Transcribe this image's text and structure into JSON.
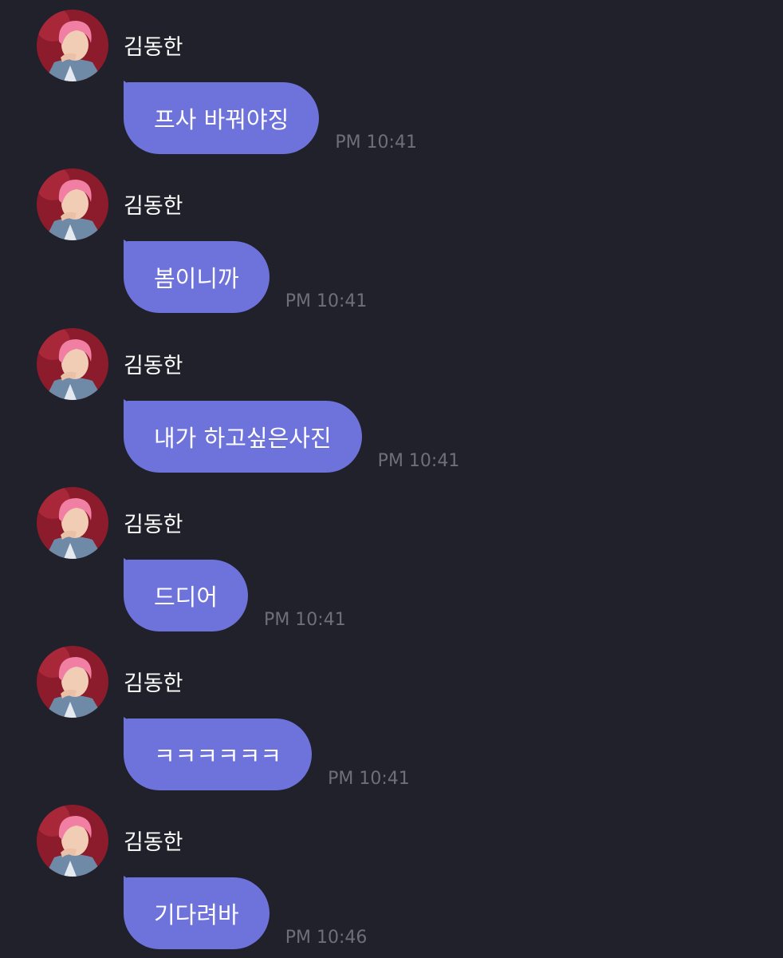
{
  "sender_name": "김동한",
  "avatar_icon": "profile-photo-avatar",
  "colors": {
    "background": "#20212a",
    "bubble": "#6e73dc",
    "bubble_text": "#ffffff",
    "timestamp": "#6e6f79"
  },
  "messages": [
    {
      "sender": "김동한",
      "text": "프사 바꿔야징",
      "time": "PM 10:41"
    },
    {
      "sender": "김동한",
      "text": "봄이니까",
      "time": "PM 10:41"
    },
    {
      "sender": "김동한",
      "text": "내가 하고싶은사진",
      "time": "PM 10:41"
    },
    {
      "sender": "김동한",
      "text": "드디어",
      "time": "PM 10:41"
    },
    {
      "sender": "김동한",
      "text": "ㅋㅋㅋㅋㅋㅋ",
      "time": "PM 10:41"
    },
    {
      "sender": "김동한",
      "text": "기다려바",
      "time": "PM 10:46"
    }
  ]
}
